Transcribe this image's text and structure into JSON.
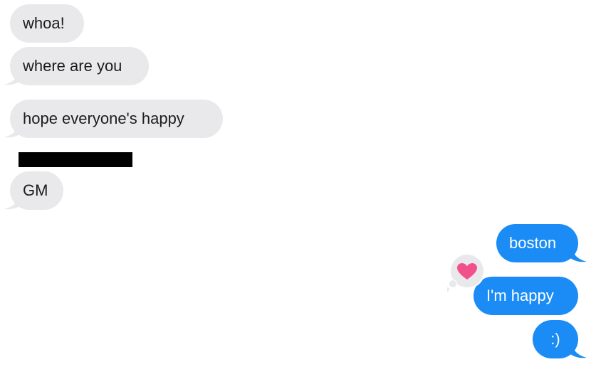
{
  "incoming": [
    {
      "text": "whoa!"
    },
    {
      "text": "where are you"
    },
    {
      "text": "hope everyone's happy"
    },
    {
      "text": "GM"
    }
  ],
  "outgoing": [
    {
      "text": "boston"
    },
    {
      "text": "I'm happy"
    },
    {
      "text": ":)"
    }
  ],
  "reaction": {
    "icon": "heart-icon",
    "color": "#f2508a"
  },
  "colors": {
    "incoming_bubble": "#e9e9eb",
    "outgoing_bubble": "#1b8cf5"
  }
}
